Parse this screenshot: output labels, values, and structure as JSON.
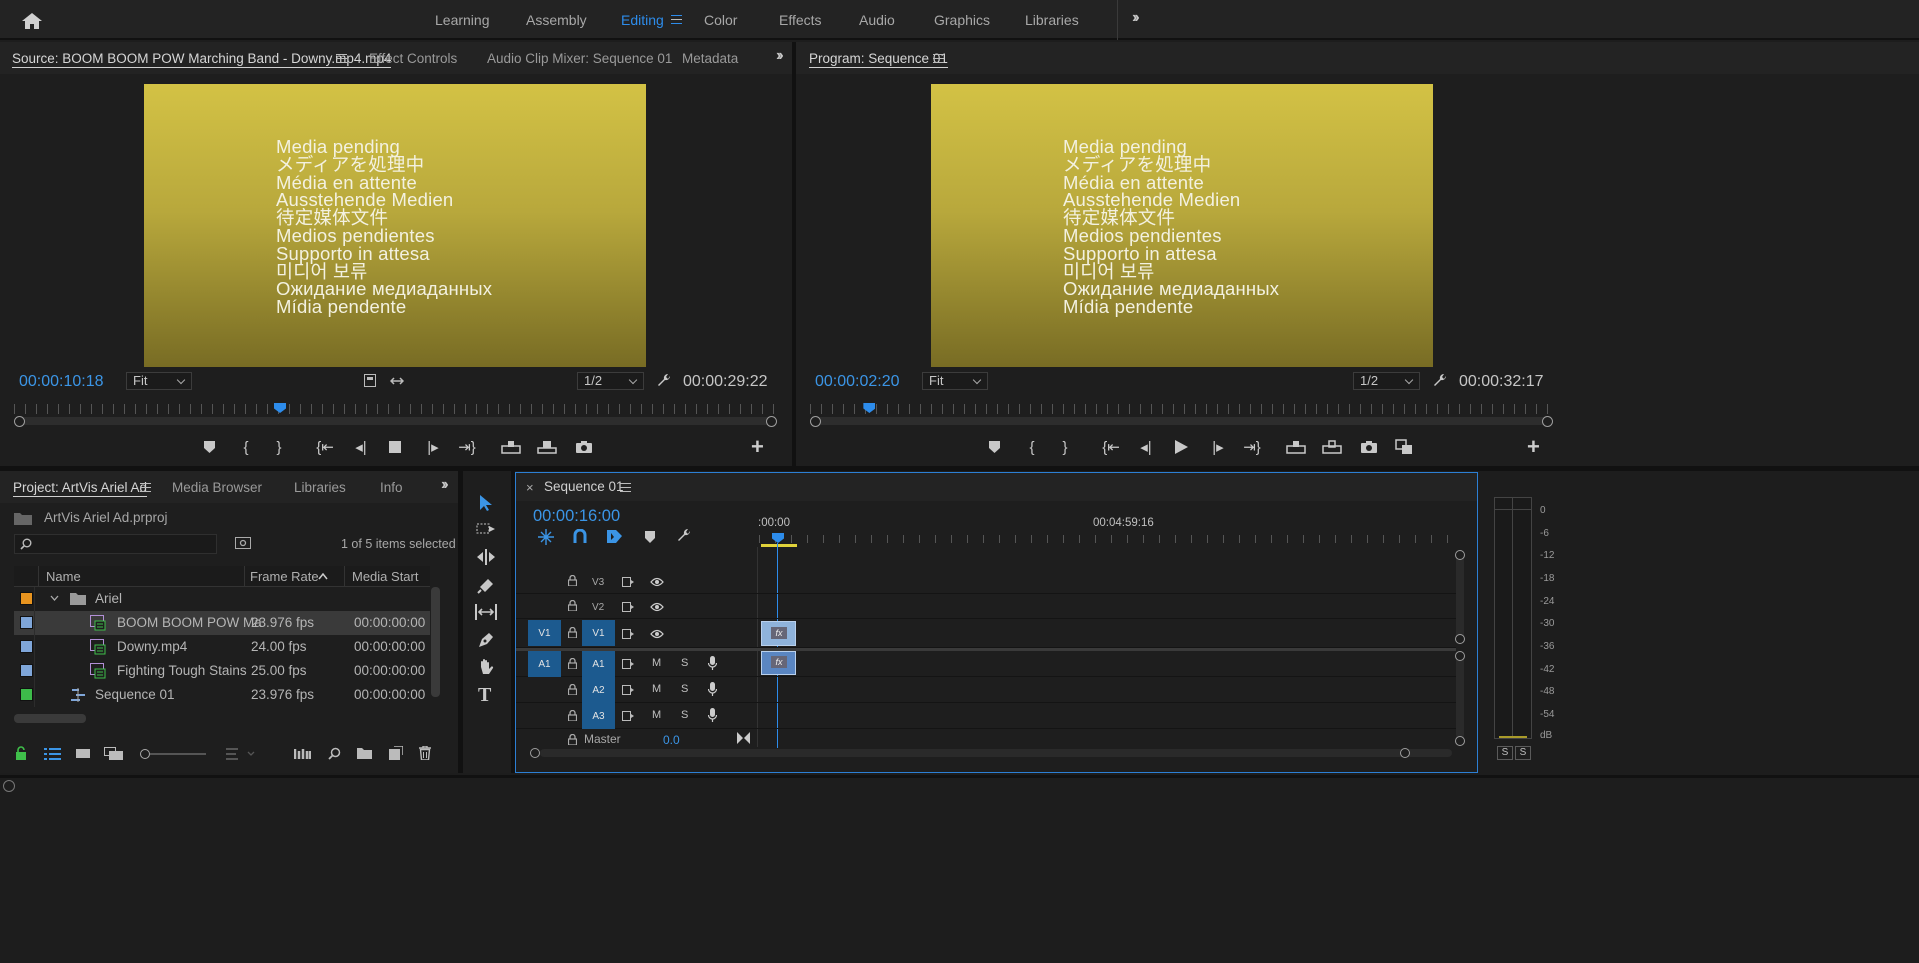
{
  "workspaces": [
    "Learning",
    "Assembly",
    "Editing",
    "Color",
    "Effects",
    "Audio",
    "Graphics",
    "Libraries"
  ],
  "active_workspace": "Editing",
  "source": {
    "tabs": [
      "Source: BOOM BOOM POW Marching Band - Downy.mp4.mp4",
      "Effect Controls",
      "Audio Clip Mixer: Sequence 01",
      "Metadata"
    ],
    "timecode": "00:00:10:18",
    "fit": "Fit",
    "resolution": "1/2",
    "duration": "00:00:29:22",
    "playhead_fraction": 0.35
  },
  "program": {
    "tab": "Program: Sequence 01",
    "timecode": "00:00:02:20",
    "fit": "Fit",
    "resolution": "1/2",
    "duration": "00:00:32:17",
    "playhead_fraction": 0.08
  },
  "media_pending": [
    "Media pending",
    "メディアを処理中",
    "Média en attente",
    "Ausstehende Medien",
    "待定媒体文件",
    "Medios pendientes",
    "Supporto in attesa",
    "미디어 보류",
    "Ожидание медиаданных",
    "Mídia pendente"
  ],
  "project": {
    "tabs": [
      "Project: ArtVis Ariel Ad",
      "Media Browser",
      "Libraries",
      "Info"
    ],
    "file": "ArtVis Ariel Ad.prproj",
    "items_selected": "1 of 5 items selected",
    "columns": [
      "Name",
      "Frame Rate",
      "Media Start"
    ],
    "rows": [
      {
        "name": "Ariel",
        "fps": "",
        "start": "",
        "color": "#e8941f",
        "type": "folder"
      },
      {
        "name": "BOOM BOOM POW Ma",
        "fps": "23.976 fps",
        "start": "00:00:00:00",
        "color": "#7fa6d9",
        "type": "clip"
      },
      {
        "name": "Downy.mp4",
        "fps": "24.00 fps",
        "start": "00:00:00:00",
        "color": "#7fa6d9",
        "type": "clip"
      },
      {
        "name": "Fighting Tough Stains",
        "fps": "25.00 fps",
        "start": "00:00:00:00",
        "color": "#7fa6d9",
        "type": "clip"
      },
      {
        "name": "Sequence 01",
        "fps": "23.976 fps",
        "start": "00:00:00:00",
        "color": "#3dbb4a",
        "type": "sequence"
      }
    ]
  },
  "timeline": {
    "tab": "Sequence 01",
    "timecode": "00:00:16:00",
    "ruler_start": ":00:00",
    "ruler_mid": "00:04:59:16",
    "video_tracks": [
      "V3",
      "V2",
      "V1"
    ],
    "audio_tracks": [
      "A1",
      "A2",
      "A3"
    ],
    "source_v": "V1",
    "source_a": "A1",
    "master_label": "Master",
    "master_value": "0.0",
    "m_label": "M",
    "s_label": "S",
    "fx_label": "fx"
  },
  "meter": {
    "labels": [
      "0",
      "-6",
      "-12",
      "-18",
      "-24",
      "-30",
      "-36",
      "-42",
      "-48",
      "-54",
      "dB"
    ],
    "solo": [
      "S",
      "S"
    ]
  }
}
